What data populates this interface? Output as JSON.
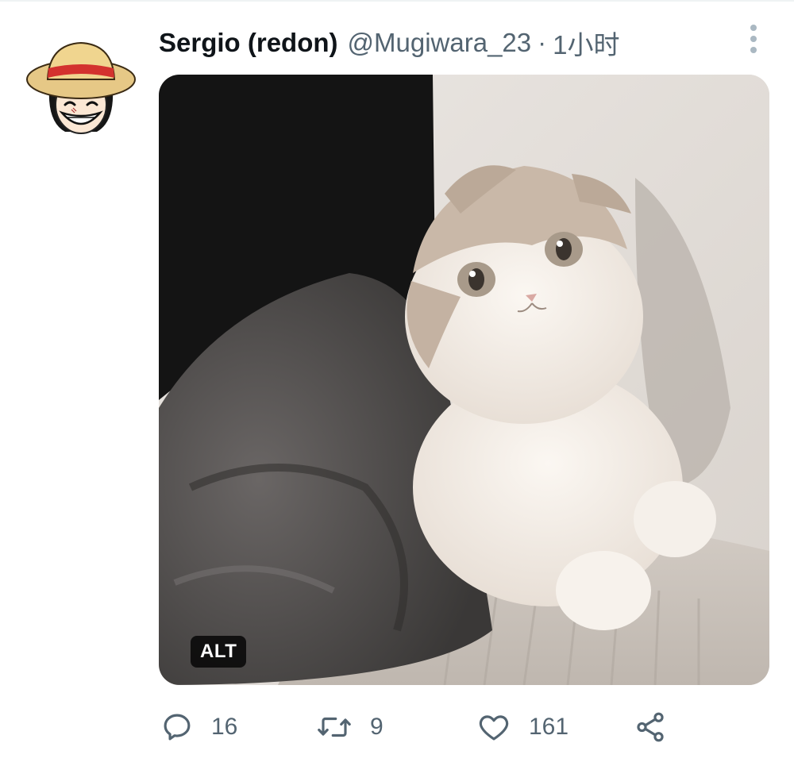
{
  "tweet": {
    "author": {
      "display_name": "Sergio (redon)",
      "handle": "@Mugiwara_23",
      "avatar_icon": "straw-hat-character-avatar"
    },
    "separator": "·",
    "timestamp": "1小时",
    "media": {
      "alt_badge": "ALT"
    },
    "actions": {
      "reply_count": "16",
      "retweet_count": "9",
      "like_count": "161"
    }
  },
  "colors": {
    "text_primary": "#0f1419",
    "text_secondary": "#536471",
    "icon_more": "#aab8c2"
  }
}
